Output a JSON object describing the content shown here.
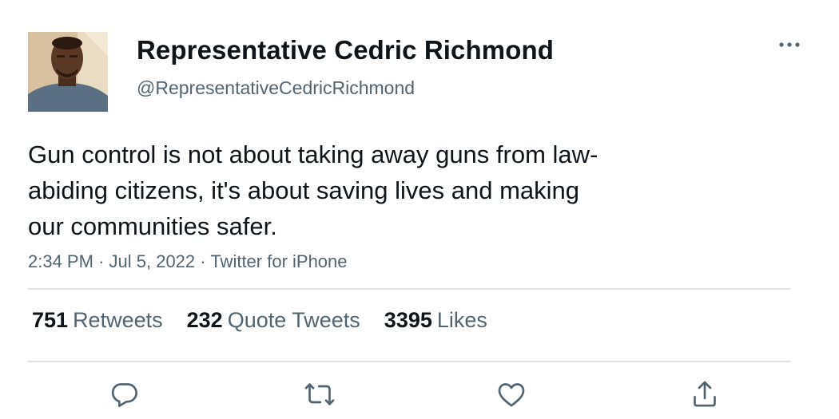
{
  "account": {
    "name": "Representative Cedric Richmond",
    "handle": "@RepresentativeCedricRichmond"
  },
  "tweet": {
    "lines": [
      "Gun control is not about taking away guns from law-",
      "abiding citizens, it's about saving lives and making",
      "our communities safer."
    ],
    "time": "2:34 PM",
    "separator": "·",
    "date": "Jul 5, 2022",
    "source": "Twitter for iPhone"
  },
  "stats": {
    "retweets_count": "751",
    "retweets_label": "Retweets",
    "quotes_count": "232",
    "quotes_label": "Quote Tweets",
    "likes_count": "3395",
    "likes_label": "Likes"
  },
  "icons": {
    "more": "more-options-icon",
    "reply": "reply-icon",
    "retweet": "retweet-icon",
    "like": "like-icon",
    "share": "share-icon"
  },
  "colors": {
    "text": "#0f1419",
    "secondary": "#536471",
    "divider": "#dfe3e6"
  }
}
